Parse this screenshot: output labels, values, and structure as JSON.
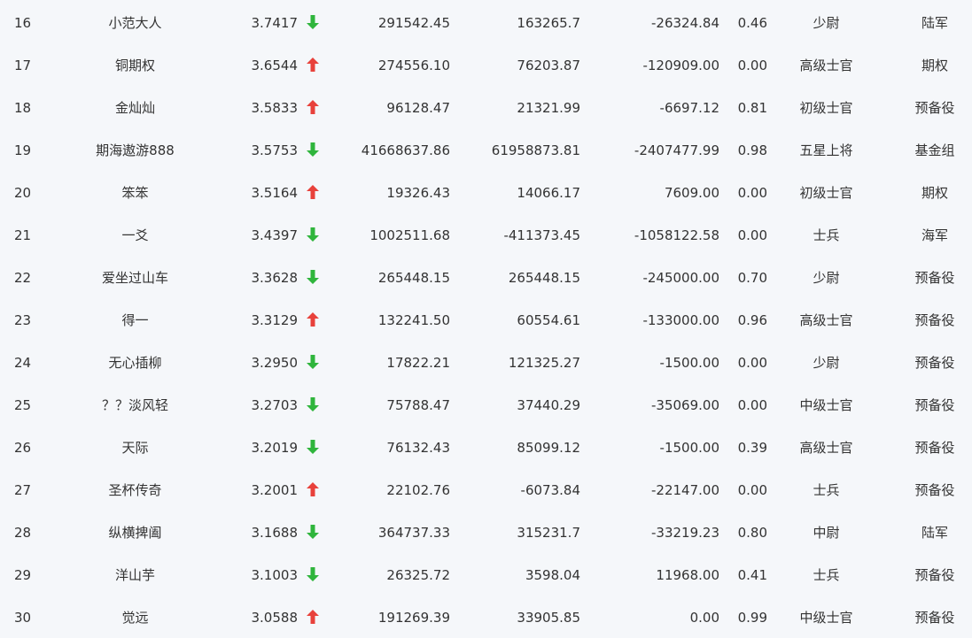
{
  "colors": {
    "up": "#e8413b",
    "down": "#2fb53c",
    "text": "#333333",
    "background": "#f5f7fa"
  },
  "rows": [
    {
      "rank": "16",
      "name": "小范大人",
      "score": "3.7417",
      "trend": "down",
      "value1": "291542.45",
      "value2": "163265.7",
      "value3": "-26324.84",
      "rate": "0.46",
      "level": "少尉",
      "group": "陆军"
    },
    {
      "rank": "17",
      "name": "铜期权",
      "score": "3.6544",
      "trend": "up",
      "value1": "274556.10",
      "value2": "76203.87",
      "value3": "-120909.00",
      "rate": "0.00",
      "level": "高级士官",
      "group": "期权"
    },
    {
      "rank": "18",
      "name": "金灿灿",
      "score": "3.5833",
      "trend": "up",
      "value1": "96128.47",
      "value2": "21321.99",
      "value3": "-6697.12",
      "rate": "0.81",
      "level": "初级士官",
      "group": "预备役"
    },
    {
      "rank": "19",
      "name": "期海遨游888",
      "score": "3.5753",
      "trend": "down",
      "value1": "41668637.86",
      "value2": "61958873.81",
      "value3": "-2407477.99",
      "rate": "0.98",
      "level": "五星上将",
      "group": "基金组"
    },
    {
      "rank": "20",
      "name": "笨笨",
      "score": "3.5164",
      "trend": "up",
      "value1": "19326.43",
      "value2": "14066.17",
      "value3": "7609.00",
      "rate": "0.00",
      "level": "初级士官",
      "group": "期权"
    },
    {
      "rank": "21",
      "name": "一爻",
      "score": "3.4397",
      "trend": "down",
      "value1": "1002511.68",
      "value2": "-411373.45",
      "value3": "-1058122.58",
      "rate": "0.00",
      "level": "士兵",
      "group": "海军"
    },
    {
      "rank": "22",
      "name": "爱坐过山车",
      "score": "3.3628",
      "trend": "down",
      "value1": "265448.15",
      "value2": "265448.15",
      "value3": "-245000.00",
      "rate": "0.70",
      "level": "少尉",
      "group": "预备役"
    },
    {
      "rank": "23",
      "name": "得一",
      "score": "3.3129",
      "trend": "up",
      "value1": "132241.50",
      "value2": "60554.61",
      "value3": "-133000.00",
      "rate": "0.96",
      "level": "高级士官",
      "group": "预备役"
    },
    {
      "rank": "24",
      "name": "无心插柳",
      "score": "3.2950",
      "trend": "down",
      "value1": "17822.21",
      "value2": "121325.27",
      "value3": "-1500.00",
      "rate": "0.00",
      "level": "少尉",
      "group": "预备役"
    },
    {
      "rank": "25",
      "name": "？？淡风轻",
      "score": "3.2703",
      "trend": "down",
      "value1": "75788.47",
      "value2": "37440.29",
      "value3": "-35069.00",
      "rate": "0.00",
      "level": "中级士官",
      "group": "预备役"
    },
    {
      "rank": "26",
      "name": "天际",
      "score": "3.2019",
      "trend": "down",
      "value1": "76132.43",
      "value2": "85099.12",
      "value3": "-1500.00",
      "rate": "0.39",
      "level": "高级士官",
      "group": "预备役"
    },
    {
      "rank": "27",
      "name": "圣杯传奇",
      "score": "3.2001",
      "trend": "up",
      "value1": "22102.76",
      "value2": "-6073.84",
      "value3": "-22147.00",
      "rate": "0.00",
      "level": "士兵",
      "group": "预备役"
    },
    {
      "rank": "28",
      "name": "纵横捭阖",
      "score": "3.1688",
      "trend": "down",
      "value1": "364737.33",
      "value2": "315231.7",
      "value3": "-33219.23",
      "rate": "0.80",
      "level": "中尉",
      "group": "陆军"
    },
    {
      "rank": "29",
      "name": "洋山芋",
      "score": "3.1003",
      "trend": "down",
      "value1": "26325.72",
      "value2": "3598.04",
      "value3": "11968.00",
      "rate": "0.41",
      "level": "士兵",
      "group": "预备役"
    },
    {
      "rank": "30",
      "name": "觉远",
      "score": "3.0588",
      "trend": "up",
      "value1": "191269.39",
      "value2": "33905.85",
      "value3": "0.00",
      "rate": "0.99",
      "level": "中级士官",
      "group": "预备役"
    }
  ]
}
